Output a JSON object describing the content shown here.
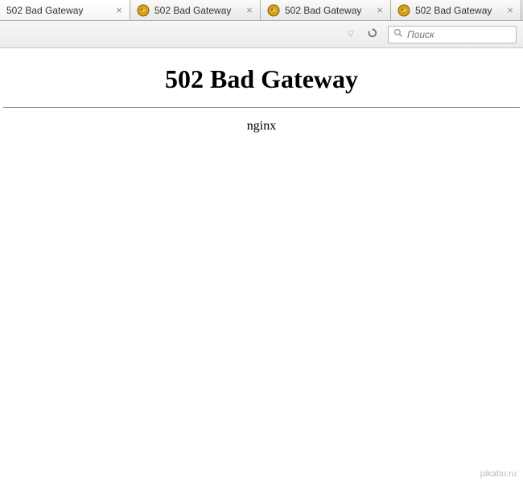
{
  "tabs": [
    {
      "title": "502 Bad Gateway",
      "active": true,
      "hasFavicon": false
    },
    {
      "title": "502 Bad Gateway",
      "active": false,
      "hasFavicon": true
    },
    {
      "title": "502 Bad Gateway",
      "active": false,
      "hasFavicon": true
    },
    {
      "title": "502 Bad Gateway",
      "active": false,
      "hasFavicon": true
    }
  ],
  "search": {
    "placeholder": "Поиск"
  },
  "page": {
    "heading": "502 Bad Gateway",
    "server": "nginx"
  },
  "watermark": "pikabu.ru"
}
